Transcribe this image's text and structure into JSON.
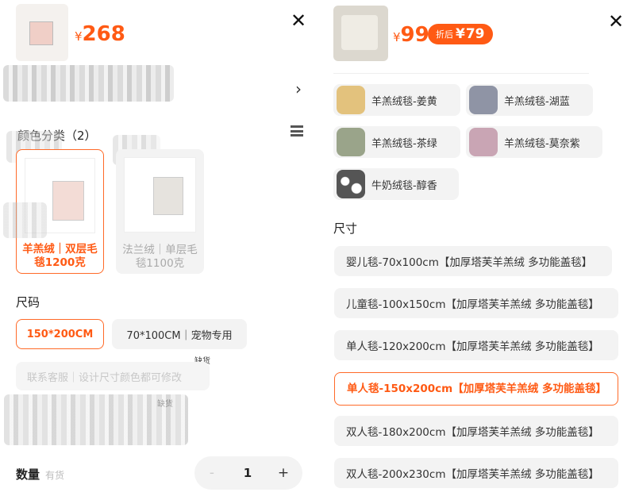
{
  "left": {
    "price": {
      "currency": "¥",
      "amount": "268"
    },
    "close_glyph": "✕",
    "chevron_glyph": "›",
    "color_section": {
      "title": "颜色分类（2）"
    },
    "color_options": [
      {
        "label": "羊羔绒｜双层毛毯1200克",
        "selected": true
      },
      {
        "label": "法兰绒｜单层毛毯1100克",
        "selected": false
      }
    ],
    "size_section": {
      "title": "尺码"
    },
    "size_options": [
      {
        "label": "150*200CM",
        "selected": true
      },
      {
        "label": "70*100CM｜宠物专用",
        "selected": false
      }
    ],
    "disabled_option": {
      "label": "联系客服｜设计尺寸颜色都可修改",
      "tag": "缺货"
    },
    "tag_below": "缺货",
    "quantity": {
      "label": "数量",
      "stock": "有货",
      "minus": "-",
      "value": "1",
      "plus": "+"
    }
  },
  "right": {
    "price": {
      "currency": "¥",
      "amount": "99"
    },
    "discount": {
      "text": "折后",
      "currency": "¥",
      "amount": "79"
    },
    "close_glyph": "✕",
    "color_options": [
      {
        "label": "羊羔绒毯-姜黄",
        "swatch": "#e3c27d"
      },
      {
        "label": "羊羔绒毯-湖蓝",
        "swatch": "#8f94a5"
      },
      {
        "label": "羊羔绒毯-茶绿",
        "swatch": "#9aa48a"
      },
      {
        "label": "羊羔绒毯-莫奈紫",
        "swatch": "#c9a5b4"
      },
      {
        "label": "牛奶绒毯-醇香",
        "swatch": "#6b6b6b"
      }
    ],
    "size_section": {
      "title": "尺寸"
    },
    "size_options": [
      {
        "label": "婴儿毯-70x100cm【加厚塔芙羊羔绒 多功能盖毯】",
        "selected": false
      },
      {
        "label": "儿童毯-100x150cm【加厚塔芙羊羔绒 多功能盖毯】",
        "selected": false
      },
      {
        "label": "单人毯-120x200cm【加厚塔芙羊羔绒 多功能盖毯】",
        "selected": false
      },
      {
        "label": "单人毯-150x200cm【加厚塔芙羊羔绒 多功能盖毯】",
        "selected": true
      },
      {
        "label": "双人毯-180x200cm【加厚塔芙羊羔绒 多功能盖毯】",
        "selected": false
      },
      {
        "label": "双人毯-200x230cm【加厚塔芙羊羔绒 多功能盖毯】",
        "selected": false
      }
    ]
  }
}
